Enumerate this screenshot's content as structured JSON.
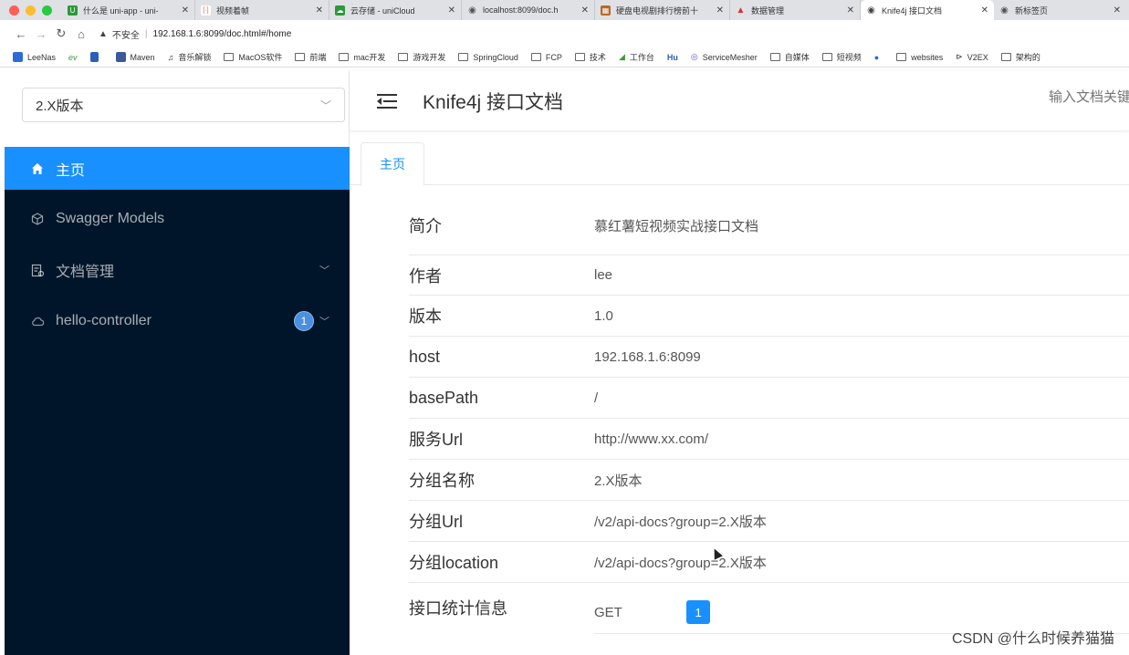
{
  "browser": {
    "tabs": [
      {
        "title": "什么是 uni-app - uni-",
        "icon_color": "#2b9939",
        "glyph": "U"
      },
      {
        "title": "视频着帧",
        "icon_color": "#e8553e",
        "glyph": "[·]"
      },
      {
        "title": "云存储 - uniCloud",
        "icon_color": "#2b9939",
        "glyph": "☁"
      },
      {
        "title": "localhost:8099/doc.h",
        "icon_color": "#555555",
        "glyph": "◉"
      },
      {
        "title": "硬盘电视剧排行榜前十",
        "icon_color": "#b56a2c",
        "glyph": "▦"
      },
      {
        "title": "数据管理",
        "icon_color": "#d0342c",
        "glyph": "▲"
      },
      {
        "title": "Knife4j 接口文档",
        "icon_color": "#444444",
        "glyph": "◉"
      },
      {
        "title": "新标签页",
        "icon_color": "#555555",
        "glyph": "◉"
      }
    ],
    "security_label": "不安全",
    "url": "192.168.1.6:8099/doc.html#/home",
    "bookmarks": [
      "LeeNas",
      "ev",
      "Maven",
      "音乐解锁",
      "MacOS软件",
      "前端",
      "mac开发",
      "游戏开发",
      "SpringCloud",
      "FCP",
      "技术",
      "工作台",
      "Hu",
      "ServiceMesher",
      "自媒体",
      "短视频",
      "websites",
      "V2EX",
      "架构的"
    ]
  },
  "sidebar": {
    "group_select": "2.X版本",
    "items": [
      {
        "label": "主页",
        "icon": "home-icon"
      },
      {
        "label": "Swagger Models",
        "icon": "cube-icon"
      },
      {
        "label": "文档管理",
        "icon": "doc-manage-icon"
      },
      {
        "label": "hello-controller",
        "icon": "cloud-icon",
        "badge": "1"
      }
    ]
  },
  "header": {
    "title": "Knife4j 接口文档",
    "search_placeholder": "输入文档关键"
  },
  "page_tab": "主页",
  "info": [
    {
      "label": "简介",
      "value": "慕红薯短视频实战接口文档"
    },
    {
      "label": "作者",
      "value": "lee"
    },
    {
      "label": "版本",
      "value": "1.0"
    },
    {
      "label": "host",
      "value": "192.168.1.6:8099"
    },
    {
      "label": "basePath",
      "value": "/"
    },
    {
      "label": "服务Url",
      "value": "http://www.xx.com/"
    },
    {
      "label": "分组名称",
      "value": "2.X版本"
    },
    {
      "label": "分组Url",
      "value": "/v2/api-docs?group=2.X版本"
    },
    {
      "label": "分组location",
      "value": "/v2/api-docs?group=2.X版本"
    }
  ],
  "stats": {
    "label": "接口统计信息",
    "method": "GET",
    "count": "1"
  },
  "watermark": "CSDN @什么时候养猫猫",
  "colors": {
    "primary": "#1890ff",
    "sidebar_bg": "#001529"
  }
}
